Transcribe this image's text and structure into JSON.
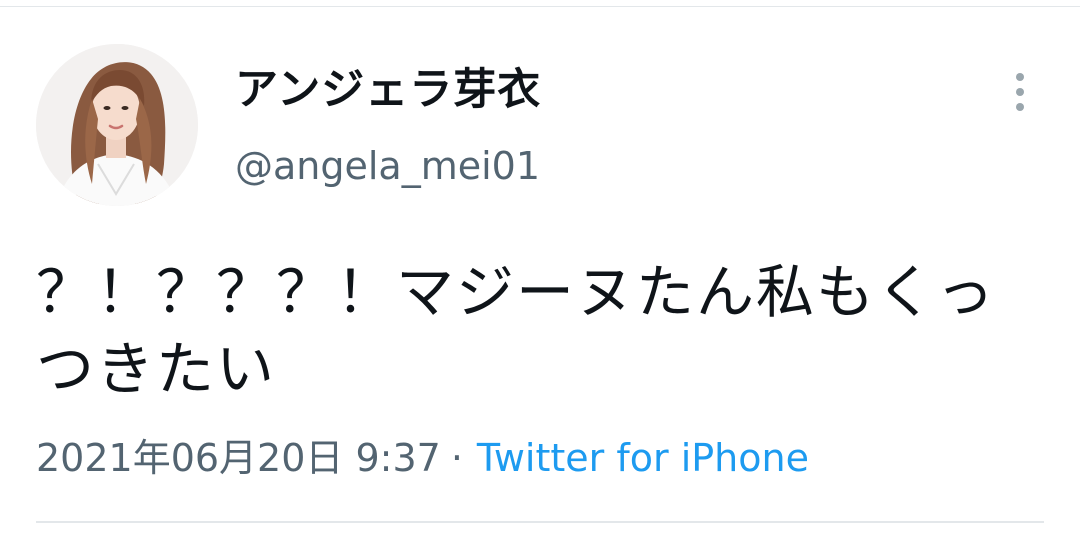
{
  "tweet": {
    "author": {
      "display_name": "アンジェラ芽衣",
      "handle": "@angela_mei01"
    },
    "text": "？！？？？！マジーヌたん私もくっつきたい",
    "timestamp": "2021年06月20日 9:37",
    "separator": "·",
    "source": "Twitter for iPhone",
    "more_icon": "more-vertical-icon"
  },
  "colors": {
    "text_primary": "#0f1419",
    "text_secondary": "#536471",
    "link": "#1d9bf0",
    "divider": "#e3e7ea",
    "more_icon": "#9aa6ad"
  }
}
